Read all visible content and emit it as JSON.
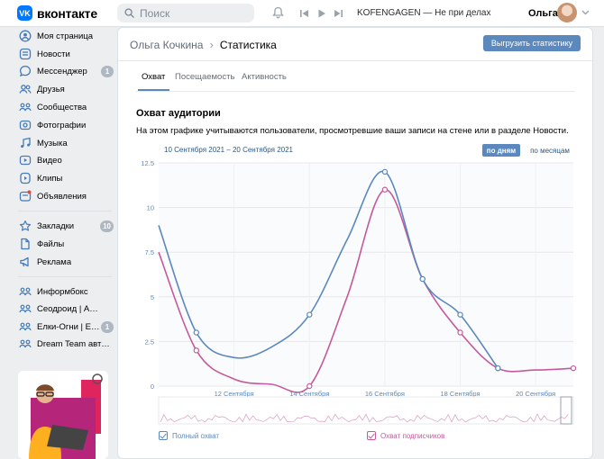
{
  "header": {
    "logo_text": "вконтакте",
    "logo_mark": "VK",
    "search_placeholder": "Поиск",
    "now_playing": "KOFENGAGEN — Не при делах",
    "user_name": "Ольга",
    "icons": [
      "search-icon",
      "bell-icon",
      "prev-track-icon",
      "play-icon",
      "next-track-icon",
      "chevron-down-icon"
    ]
  },
  "sidebar": {
    "items": [
      {
        "label": "Моя страница",
        "icon": "user-icon"
      },
      {
        "label": "Новости",
        "icon": "news-icon"
      },
      {
        "label": "Мессенджер",
        "icon": "chat-icon",
        "badge": "1"
      },
      {
        "label": "Друзья",
        "icon": "friends-icon"
      },
      {
        "label": "Сообщества",
        "icon": "groups-icon"
      },
      {
        "label": "Фотографии",
        "icon": "photo-icon"
      },
      {
        "label": "Музыка",
        "icon": "music-icon"
      },
      {
        "label": "Видео",
        "icon": "video-icon"
      },
      {
        "label": "Клипы",
        "icon": "clips-icon"
      },
      {
        "label": "Объявления",
        "icon": "ads-icon"
      },
      {
        "label": "Закладки",
        "icon": "star-icon",
        "badge": "10"
      },
      {
        "label": "Файлы",
        "icon": "files-icon"
      },
      {
        "label": "Реклама",
        "icon": "megaphone-icon"
      },
      {
        "label": "Информбокс",
        "icon": "groups-icon"
      },
      {
        "label": "Сеодроид | Авто...",
        "icon": "groups-icon"
      },
      {
        "label": "Елки-Огни | Ел...",
        "icon": "groups-icon",
        "badge": "1"
      },
      {
        "label": "Dream Team автор...",
        "icon": "groups-icon"
      }
    ]
  },
  "main": {
    "breadcrumb": {
      "parent": "Ольга Кочкина",
      "current": "Статистика"
    },
    "export_label": "Выгрузить статистику",
    "tabs": [
      {
        "label": "Охват",
        "active": true
      },
      {
        "label": "Посещаемость",
        "active": false
      },
      {
        "label": "Активность",
        "active": false
      }
    ],
    "section_title": "Охват аудитории",
    "section_desc": "На этом графике учитываются пользователи, просмотревшие ваши записи на стене или в разделе Новости.",
    "date_range": "10 Сентября 2021 – 20 Сентября 2021",
    "period_on": "по дням",
    "period_off": "по месяцам"
  },
  "chart_data": {
    "type": "line",
    "x": [
      "10 Сентября",
      "11 Сентября",
      "12 Сентября",
      "13 Сентября",
      "14 Сентября",
      "15 Сентября",
      "16 Сентября",
      "17 Сентября",
      "18 Сентября",
      "19 Сентября",
      "20 Сентября",
      "21 Сентября"
    ],
    "x_tick_labels": [
      "12 Сентября",
      "14 Сентября",
      "16 Сентября",
      "18 Сентября",
      "20 Сентября"
    ],
    "y_tick_labels": [
      "0",
      "2.5",
      "5",
      "7.5",
      "10",
      "12.5"
    ],
    "ylim": [
      0,
      12.5
    ],
    "series": [
      {
        "name": "Полный охват",
        "color": "#5b88bd",
        "values": [
          9,
          3,
          1.6,
          2.2,
          4,
          8.2,
          12,
          6,
          4,
          1,
          null,
          null
        ]
      },
      {
        "name": "Охват подписчиков",
        "color": "#c45a9b",
        "values": [
          7.5,
          2,
          0.4,
          0.1,
          0,
          5,
          11,
          6,
          3,
          1,
          0.9,
          1
        ]
      }
    ],
    "markers": {
      "Полный охват": [
        1,
        4,
        6,
        7,
        8,
        9
      ],
      "Охват подписчиков": [
        1,
        4,
        6,
        7,
        8,
        9,
        11
      ]
    },
    "grid": true,
    "legend": "bottom-left"
  }
}
